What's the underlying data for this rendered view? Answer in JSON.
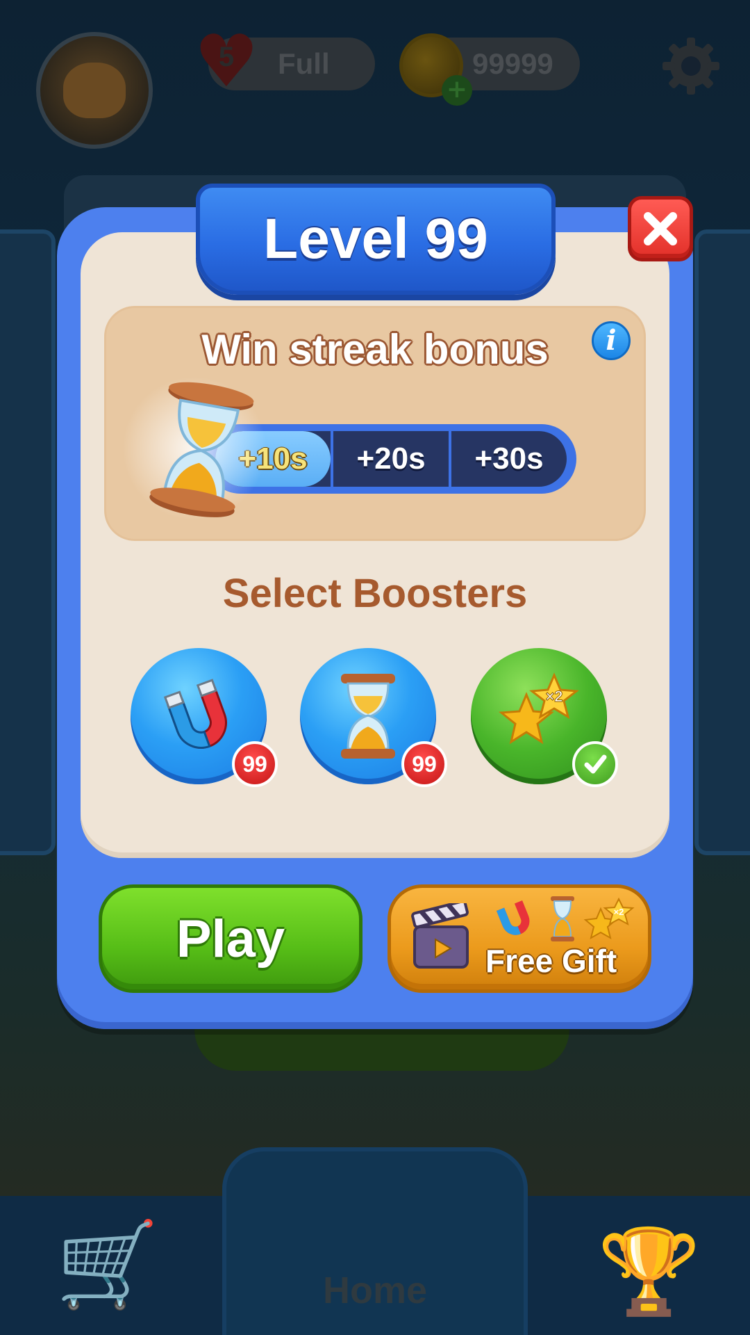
{
  "hud": {
    "lives_count": "5",
    "lives_status": "Full",
    "coins": "99999"
  },
  "dialog": {
    "title": "Level 99",
    "streak": {
      "title": "Win streak bonus",
      "info_symbol": "i",
      "steps": [
        "+10s",
        "+20s",
        "+30s"
      ],
      "active_step": 0
    },
    "boosters": {
      "title": "Select Boosters",
      "items": [
        {
          "name": "magnet",
          "count": "99",
          "selected": false
        },
        {
          "name": "hourglass",
          "count": "99",
          "selected": false
        },
        {
          "name": "double-star",
          "label": "×2",
          "selected": true
        }
      ]
    },
    "play_label": "Play",
    "gift_label": "Free Gift",
    "gift_star_label": "×2"
  },
  "nav": {
    "home_label": "Home"
  },
  "colors": {
    "dialog_blue": "#4d80ee",
    "panel_cream": "#efe4d6",
    "play_green": "#56bd17",
    "gift_orange": "#eb9a1c",
    "close_red": "#e23029",
    "badge_red": "#c41515"
  },
  "icons": {
    "close": "close-x-icon",
    "info": "info-icon",
    "streak": "hourglass-icon",
    "booster_1": "magnet-icon",
    "booster_2": "hourglass-icon",
    "booster_3": "double-star-icon",
    "gift_video": "clapperboard-icon"
  }
}
